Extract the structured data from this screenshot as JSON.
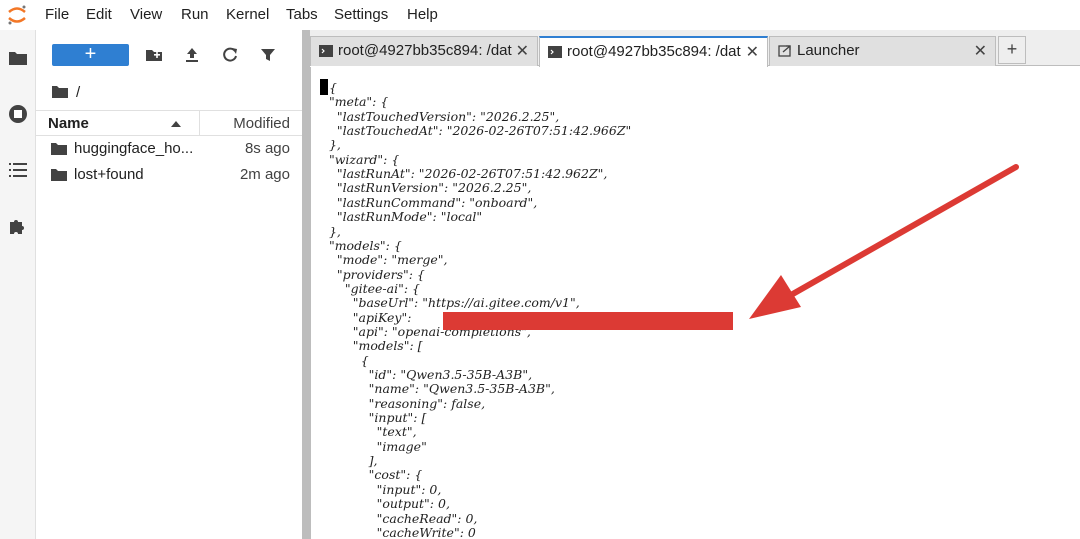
{
  "menu": [
    "File",
    "Edit",
    "View",
    "Run",
    "Kernel",
    "Tabs",
    "Settings",
    "Help"
  ],
  "toolbar": {
    "new_label": "+"
  },
  "breadcrumb": {
    "path": "/"
  },
  "file_list": {
    "headers": {
      "name": "Name",
      "modified": "Modified"
    },
    "rows": [
      {
        "name": "huggingface_ho...",
        "modified": "8s ago"
      },
      {
        "name": "lost+found",
        "modified": "2m ago"
      }
    ]
  },
  "tabs": [
    {
      "label": "root@4927bb35c894: /dat",
      "close": "✕",
      "icon": "terminal-icon"
    },
    {
      "label": "root@4927bb35c894: /dat",
      "close": "✕",
      "icon": "terminal-icon"
    },
    {
      "label": "Launcher",
      "close": "✕",
      "icon": "launcher-icon"
    }
  ],
  "add_tab_label": "+",
  "terminal": {
    "lines": [
      "{",
      "  \"meta\": {",
      "    \"lastTouchedVersion\": \"2026.2.25\",",
      "    \"lastTouchedAt\": \"2026-02-26T07:51:42.966Z\"",
      "  },",
      "  \"wizard\": {",
      "    \"lastRunAt\": \"2026-02-26T07:51:42.962Z\",",
      "    \"lastRunVersion\": \"2026.2.25\",",
      "    \"lastRunCommand\": \"onboard\",",
      "    \"lastRunMode\": \"local\"",
      "  },",
      "  \"models\": {",
      "    \"mode\": \"merge\",",
      "    \"providers\": {",
      "      \"gitee-ai\": {",
      "        \"baseUrl\": \"https://ai.gitee.com/v1\",",
      "        \"apiKey\":",
      "        \"api\": \"openai-completions\",",
      "        \"models\": [",
      "          {",
      "            \"id\": \"Qwen3.5-35B-A3B\",",
      "            \"name\": \"Qwen3.5-35B-A3B\",",
      "            \"reasoning\": false,",
      "            \"input\": [",
      "              \"text\",",
      "              \"image\"",
      "            ],",
      "            \"cost\": {",
      "              \"input\": 0,",
      "              \"output\": 0,",
      "              \"cacheRead\": 0,",
      "              \"cacheWrite\": 0"
    ]
  },
  "colors": {
    "accent": "#2f7fd2",
    "annotation": "#dc3a34"
  }
}
